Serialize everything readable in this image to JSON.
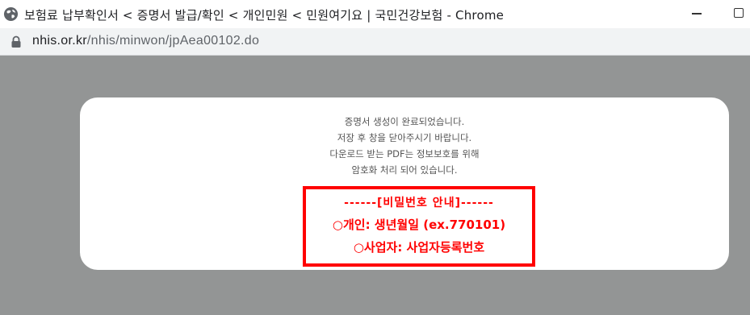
{
  "window": {
    "title": "보험료 납부확인서 < 증명서 발급/확인 < 개인민원 < 민원여기요 | 국민건강보험 - Chrome"
  },
  "address_bar": {
    "host": "nhis.or.kr",
    "path": "/nhis/minwon/jpAea00102.do"
  },
  "dialog": {
    "message_lines": [
      "증명서 생성이 완료되었습니다.",
      "저장 후 창을 닫아주시기 바랍니다.",
      "다운로드 받는 PDF는 정보보호를 위해",
      "암호화 처리 되어 있습니다."
    ],
    "password_notice": {
      "header": "------[비밀번호 안내]------",
      "personal": "○개인: 생년월일 (ex.770101)",
      "business": "○사업자: 사업자등록번호"
    }
  },
  "colors": {
    "overlay_bg": "#939595",
    "notice_red": "#ff0000"
  },
  "icons": {
    "favicon": "globe-icon",
    "security": "lock-icon"
  }
}
